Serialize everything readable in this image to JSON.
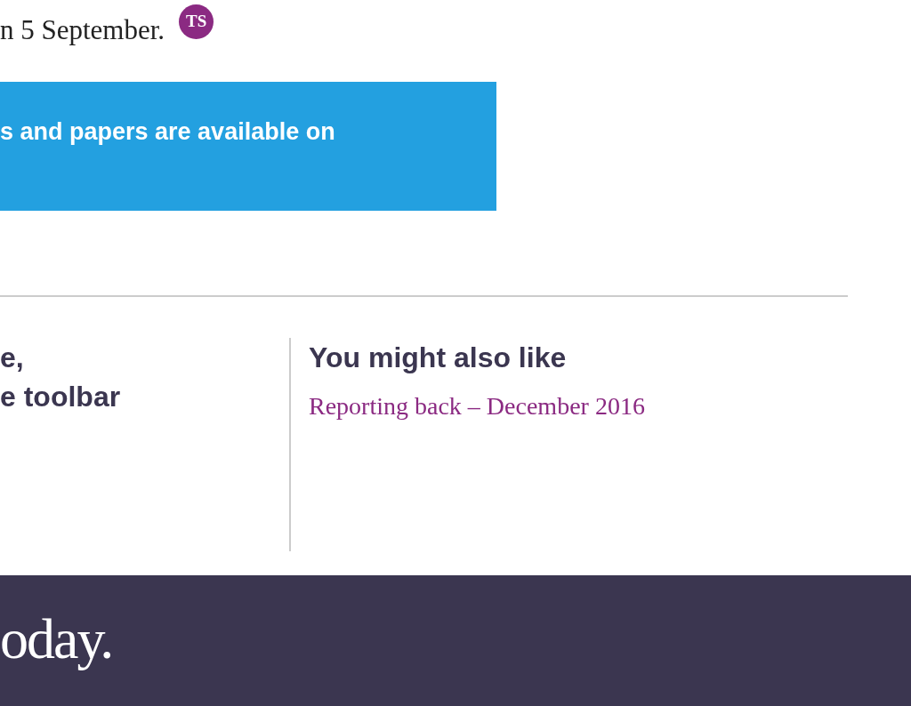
{
  "intro": {
    "text": "n 5 September.",
    "badge": "TS"
  },
  "callout": {
    "text": "s and papers are available on"
  },
  "left_heading": {
    "lines": [
      "e,",
      "e toolbar"
    ]
  },
  "related": {
    "title": "You might also like",
    "links": [
      "Reporting back – December 2016"
    ]
  },
  "footer": {
    "logo": "oday."
  }
}
